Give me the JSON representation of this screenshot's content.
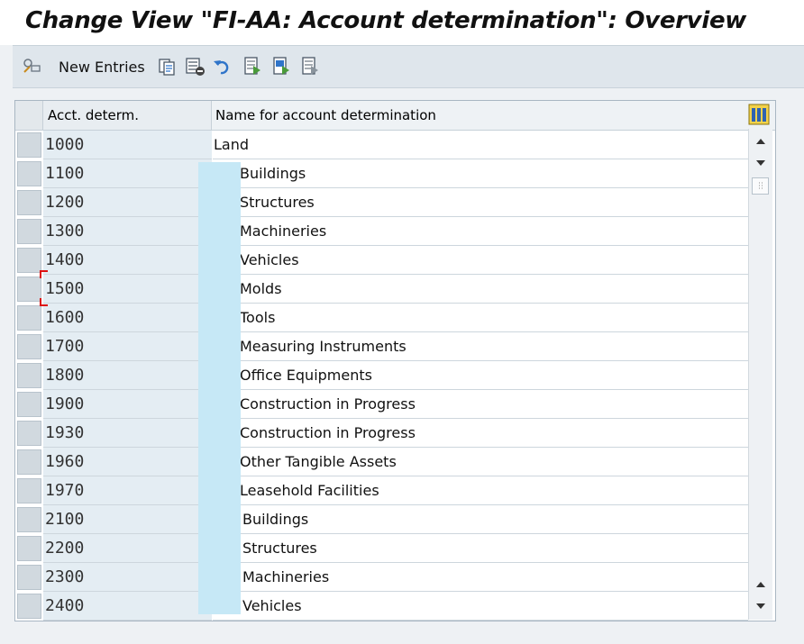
{
  "window": {
    "title": "Change View \"FI-AA: Account determination\": Overview"
  },
  "toolbar": {
    "new_entries_label": "New Entries",
    "icons": [
      "display-change-icon",
      "copy-icon",
      "delete-icon",
      "undo-icon",
      "select-all-icon",
      "select-block-icon",
      "deselect-all-icon"
    ]
  },
  "table": {
    "columns": [
      "Acct. determ.",
      "Name for account determination"
    ],
    "rows": [
      {
        "code": "1000",
        "name": "Land"
      },
      {
        "code": "1100",
        "name": "Buildings"
      },
      {
        "code": "1200",
        "name": "Structures"
      },
      {
        "code": "1300",
        "name": "Machineries"
      },
      {
        "code": "1400",
        "name": "Vehicles"
      },
      {
        "code": "1500",
        "name": "Molds"
      },
      {
        "code": "1600",
        "name": "Tools"
      },
      {
        "code": "1700",
        "name": "Measuring Instruments"
      },
      {
        "code": "1800",
        "name": "Office Equipments"
      },
      {
        "code": "1900",
        "name": "Construction in Progress"
      },
      {
        "code": "1930",
        "name": "Construction in Progress"
      },
      {
        "code": "1960",
        "name": "Other Tangible Assets"
      },
      {
        "code": "1970",
        "name": "Leasehold Facilities"
      },
      {
        "code": "2100",
        "name": "Buildings"
      },
      {
        "code": "2200",
        "name": "Structures"
      },
      {
        "code": "2300",
        "name": "Machineries"
      },
      {
        "code": "2400",
        "name": "Vehicles"
      }
    ]
  },
  "colors": {
    "key_column_bg": "#e4edf3",
    "toolbar_bg": "#dfe6ec",
    "redaction": "#c6e8f6"
  }
}
